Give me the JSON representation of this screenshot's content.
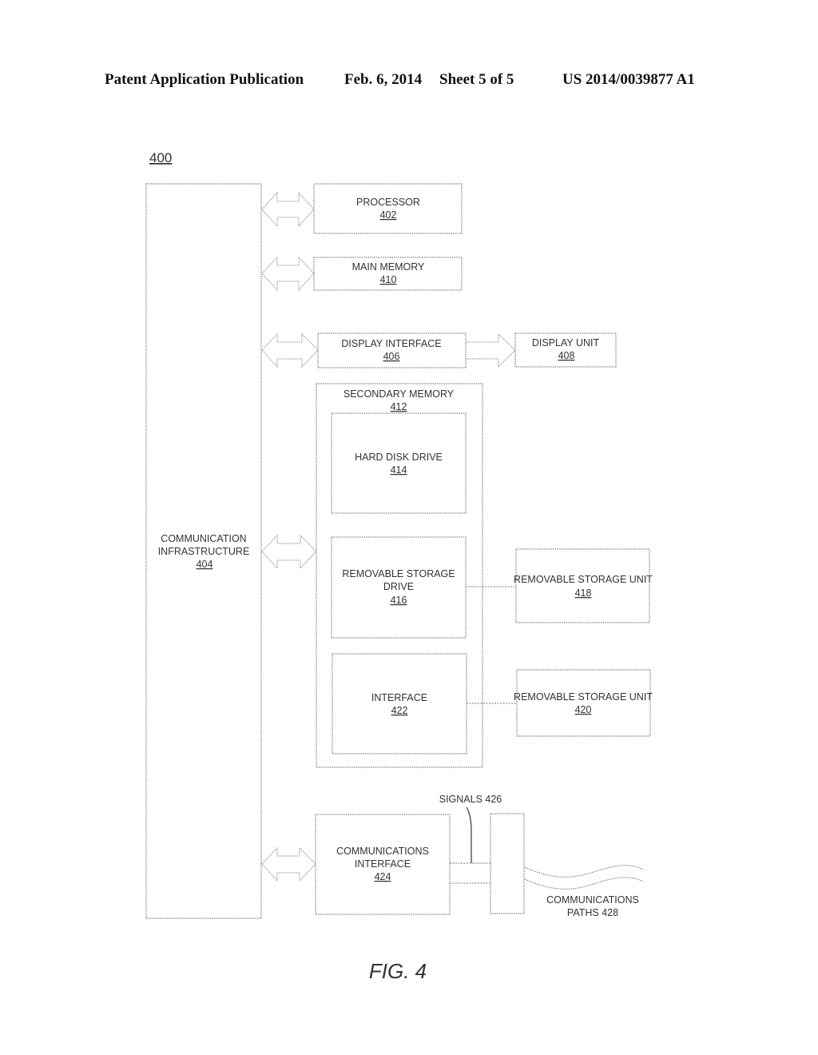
{
  "header": {
    "publication_type": "Patent Application Publication",
    "date": "Feb. 6, 2014",
    "sheet": "Sheet 5 of 5",
    "patent_number": "US 2014/0039877 A1"
  },
  "figure": {
    "reference": "400",
    "caption": "FIG. 4",
    "blocks": {
      "communication_infrastructure": {
        "lines": [
          "COMMUNICATION",
          "INFRASTRUCTURE"
        ],
        "number": "404"
      },
      "processor": {
        "lines": [
          "PROCESSOR"
        ],
        "number": "402"
      },
      "main_memory": {
        "lines": [
          "MAIN MEMORY"
        ],
        "number": "410"
      },
      "display_interface": {
        "lines": [
          "DISPLAY INTERFACE"
        ],
        "number": "406"
      },
      "display_unit": {
        "lines": [
          "DISPLAY UNIT"
        ],
        "number": "408"
      },
      "secondary_memory": {
        "lines": [
          "SECONDARY MEMORY"
        ],
        "number": "412"
      },
      "hard_disk_drive": {
        "lines": [
          "HARD DISK DRIVE"
        ],
        "number": "414"
      },
      "removable_storage_drive": {
        "lines": [
          "REMOVABLE STORAGE",
          "DRIVE"
        ],
        "number": "416"
      },
      "removable_storage_unit_418": {
        "lines": [
          "REMOVABLE STORAGE UNIT"
        ],
        "number": "418"
      },
      "interface": {
        "lines": [
          "INTERFACE"
        ],
        "number": "422"
      },
      "removable_storage_unit_420": {
        "lines": [
          "REMOVABLE STORAGE UNIT"
        ],
        "number": "420"
      },
      "communications_interface": {
        "lines": [
          "COMMUNICATIONS",
          "INTERFACE"
        ],
        "number": "424"
      }
    },
    "labels": {
      "signals": "SIGNALS 426",
      "communications_paths_line1": "COMMUNICATIONS",
      "communications_paths_line2": "PATHS 428"
    }
  }
}
